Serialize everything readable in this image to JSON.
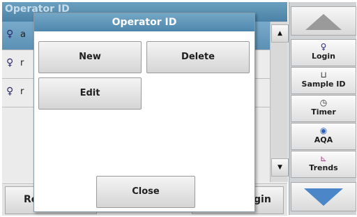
{
  "app": {
    "title": "Operator ID",
    "rows": [
      {
        "icon": "person-icon",
        "text": "a"
      },
      {
        "icon": "person-icon",
        "text": "r"
      },
      {
        "icon": "person-icon",
        "text": "r"
      }
    ],
    "bottom": {
      "left_label": "Re",
      "right_label": "gin"
    }
  },
  "sidebar": {
    "login_label": "Login",
    "sample_id_label": "Sample ID",
    "timer_label": "Timer",
    "aqa_label": "AQA",
    "trends_label": "Trends"
  },
  "dialog": {
    "title": "Operator ID",
    "new_label": "New",
    "delete_label": "Delete",
    "edit_label": "Edit",
    "close_label": "Close"
  },
  "colors": {
    "title_bar": "#5a90b5",
    "nav_arrow": "#4a86c8"
  }
}
